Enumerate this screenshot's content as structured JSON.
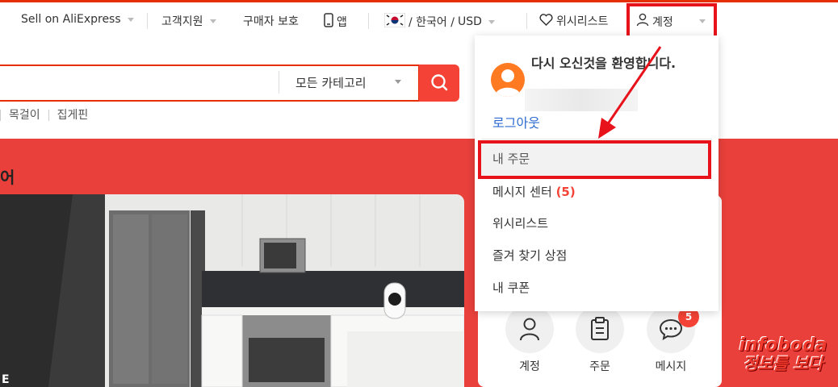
{
  "topbar": {
    "sell": "Sell on AliExpress",
    "support": "고객지원",
    "buyer_protection": "구매자 보호",
    "app": "앱",
    "locale": "/ 한국어 /",
    "currency": "USD",
    "wishlist": "위시리스트",
    "account": "계정"
  },
  "search": {
    "category": "모든 카테고리"
  },
  "hot_keywords": [
    "목걸이",
    "집게핀"
  ],
  "banner": {
    "title_fragment": "어",
    "text_fragment": "E"
  },
  "account_dropdown": {
    "welcome": "다시 오신것을 환영합니다.",
    "logout": "로그아웃",
    "items": [
      {
        "label": "내 주문"
      },
      {
        "label": "메시지 센터",
        "count": "(5)"
      },
      {
        "label": "위시리스트"
      },
      {
        "label": "즐겨 찾기 상점"
      },
      {
        "label": "내 쿠폰"
      }
    ]
  },
  "quick_actions": [
    {
      "label": "계정",
      "icon": "person-icon"
    },
    {
      "label": "주문",
      "icon": "clipboard-icon"
    },
    {
      "label": "메시지",
      "icon": "chat-icon",
      "badge": "5"
    }
  ],
  "watermark": {
    "line1": "infoboda",
    "line2": "정보를 보다"
  },
  "colors": {
    "brand_red": "#e62e04",
    "banner_red": "#e9403b",
    "annotation_red": "#e8121a",
    "link_blue": "#2e6bd1"
  }
}
